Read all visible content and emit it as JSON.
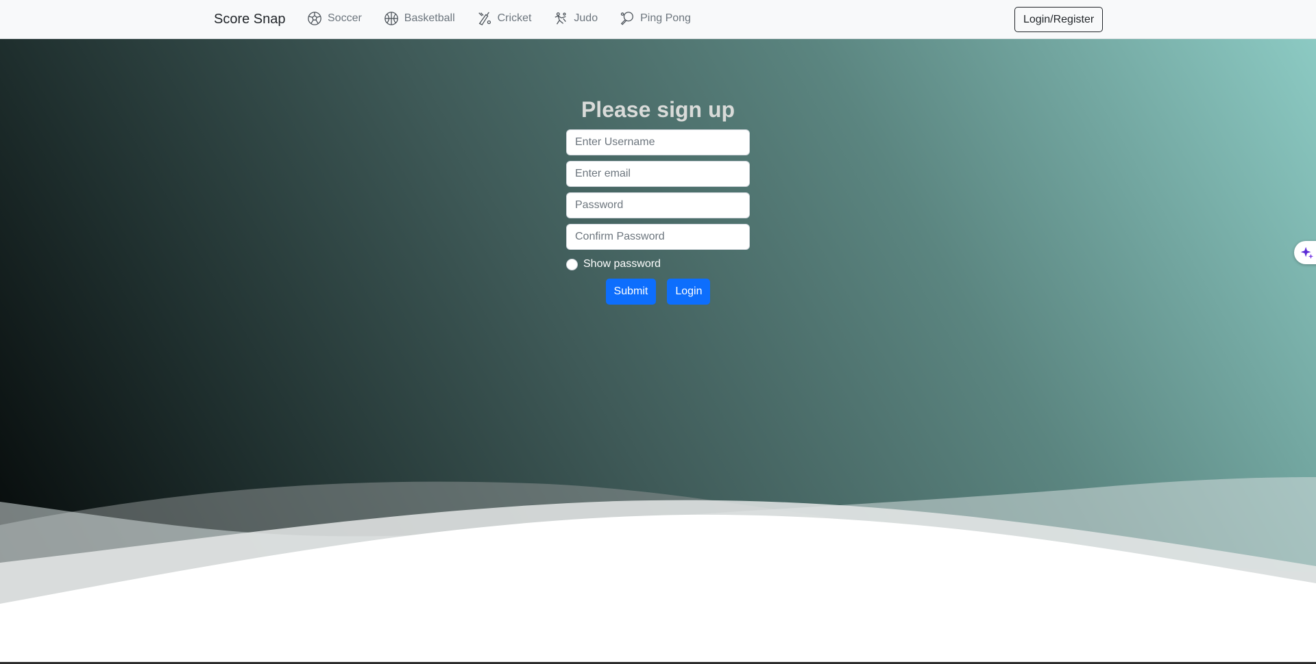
{
  "navbar": {
    "brand": "Score Snap",
    "links": [
      {
        "label": "Soccer",
        "icon": "soccer-ball-icon"
      },
      {
        "label": "Basketball",
        "icon": "basketball-icon"
      },
      {
        "label": "Cricket",
        "icon": "cricket-icon"
      },
      {
        "label": "Judo",
        "icon": "judo-icon"
      },
      {
        "label": "Ping Pong",
        "icon": "ping-pong-icon"
      }
    ],
    "login_register_label": "Login/Register"
  },
  "signup": {
    "title": "Please sign up",
    "username_placeholder": "Enter Username",
    "email_placeholder": "Enter email",
    "password_placeholder": "Password",
    "confirm_password_placeholder": "Confirm Password",
    "show_password_label": "Show password",
    "submit_label": "Submit",
    "login_label": "Login"
  },
  "side_widget": {
    "icon": "sparkle-icon"
  },
  "colors": {
    "primary": "#0d6efd",
    "navbar_bg": "#f8f9fa",
    "gradient_start": "#020404",
    "gradient_end": "#8ccac3"
  }
}
